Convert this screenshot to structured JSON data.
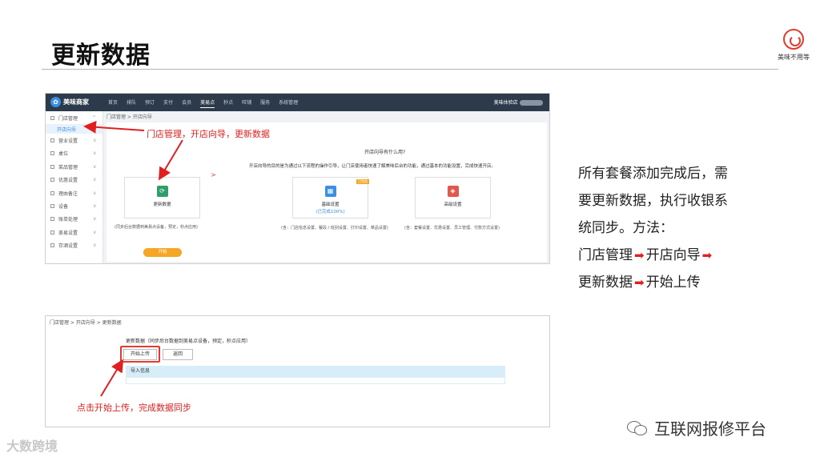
{
  "slide": {
    "title": "更新数据",
    "logo_text": "美味不用等",
    "logo_subtext": "大数据跨境"
  },
  "screenshot1": {
    "brand": "美味商家",
    "nav": [
      "首页",
      "排队",
      "预订",
      "支付",
      "会员",
      "美易点",
      "秒点",
      "旺铺",
      "服务",
      "系统管理"
    ],
    "nav_active_index": 5,
    "store_name": "美味体验店",
    "sidebar": {
      "items": [
        {
          "label": "门店管理",
          "chevron": "^"
        },
        {
          "label": "营业设置",
          "chevron": "v"
        },
        {
          "label": "桌位",
          "chevron": "v"
        },
        {
          "label": "菜品管理",
          "chevron": "v"
        },
        {
          "label": "优惠设置",
          "chevron": "v"
        },
        {
          "label": "理由备注",
          "chevron": "v"
        },
        {
          "label": "设备",
          "chevron": "v"
        },
        {
          "label": "账单处理",
          "chevron": "v"
        },
        {
          "label": "美易设置",
          "chevron": "v"
        },
        {
          "label": "存酒设置",
          "chevron": "v"
        }
      ],
      "active_sub": "开店向导"
    },
    "breadcrumb": "门店管理 > 开店向导",
    "question_title": "开店向导有什么用?",
    "question_desc": "开店向导的目的是为通过以下流程的操作引导，让门店使用者快速了解美味后台的功能，通过基本的功能设置，完成快速开店。",
    "cards": [
      {
        "label": "更新数据",
        "sub": "",
        "icon": "refresh-icon",
        "color": "#2e9e6b",
        "desc": "(同步后台数据到美易点设备，预定，秒点应用)"
      },
      {
        "label": "基础设置",
        "sub": "(已完成100%)",
        "icon": "grid-icon",
        "color": "#3b8fe0",
        "tag": "已完成",
        "desc": "(含：门店信息设置、餐段 / 班别设置、打印设置、菜品设置)"
      },
      {
        "label": "高级设置",
        "sub": "",
        "icon": "layers-icon",
        "color": "#e4574b",
        "desc": "(含：套餐设置、优惠设置、员工管理、付款方式设置)"
      }
    ],
    "start_button": "开始",
    "arrow_glyph": ">",
    "annotation": "门店管理，开店向导，更新数据"
  },
  "screenshot2": {
    "breadcrumb": "门店管理 > 开店向导 > 更新数据",
    "update_label": "更新数据（同步后台数据到美易点设备，预定，秒点应用）",
    "upload_button": "开始上传",
    "back_button": "返回",
    "import_info": "导入信息",
    "annotation": "点击开始上传，完成数据同步"
  },
  "description": {
    "line1": "所有套餐添加完成后，需",
    "line2": "要更新数据，执行收银系",
    "line3": "统同步。方法：",
    "step1": "门店管理",
    "step2": "开店向导",
    "step3": "更新数据",
    "step4": "开始上传",
    "arrow": "➡"
  },
  "footer": {
    "wechat_name": "互联网报修平台",
    "watermark": "大数跨境"
  },
  "colors": {
    "accent_red": "#e02020",
    "nav_dark": "#2d3a4b",
    "orange": "#f5a623",
    "blue": "#3b8fe0"
  }
}
